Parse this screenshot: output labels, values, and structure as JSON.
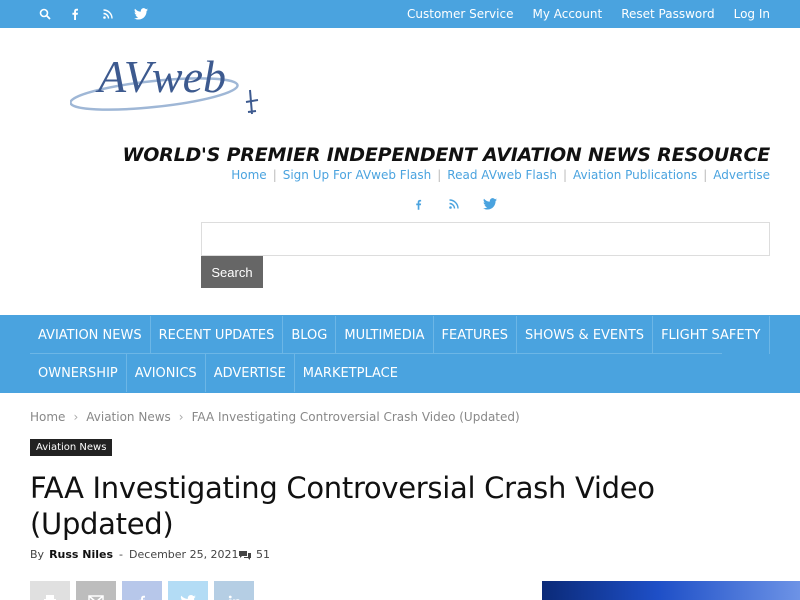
{
  "topbar": {
    "icons": [
      "search-icon",
      "facebook-icon",
      "rss-icon",
      "twitter-icon"
    ],
    "links": [
      "Customer Service",
      "My Account",
      "Reset Password",
      "Log In"
    ]
  },
  "header": {
    "logo_text": "AVweb",
    "tagline": "WORLD'S PREMIER INDEPENDENT AVIATION NEWS RESOURCE",
    "links": [
      "Home",
      "Sign Up For AVweb Flash",
      "Read AVweb Flash",
      "Aviation Publications",
      "Advertise"
    ],
    "social_icons": [
      "facebook-icon",
      "rss-icon",
      "twitter-icon"
    ],
    "search": {
      "value": "",
      "button_label": "Search"
    }
  },
  "nav": {
    "row1": [
      "Aviation News",
      "Recent Updates",
      "Blog",
      "Multimedia",
      "Features",
      "Shows & Events",
      "Flight Safety"
    ],
    "row2": [
      "Ownership",
      "Avionics",
      "Advertise",
      "Marketplace"
    ]
  },
  "breadcrumb": [
    "Home",
    "Aviation News",
    "FAA Investigating Controversial Crash Video (Updated)"
  ],
  "article": {
    "category": "Aviation News",
    "title": "FAA Investigating Controversial Crash Video (Updated)",
    "by_label": "By",
    "author": "Russ Niles",
    "date": "December 25, 2021",
    "comment_count": "51",
    "share_icons": [
      "print-icon",
      "email-icon",
      "facebook-icon",
      "twitter-icon",
      "linkedin-icon"
    ]
  },
  "colors": {
    "brand_blue": "#4aa3df",
    "dark": "#222222",
    "button_gray": "#666666"
  }
}
